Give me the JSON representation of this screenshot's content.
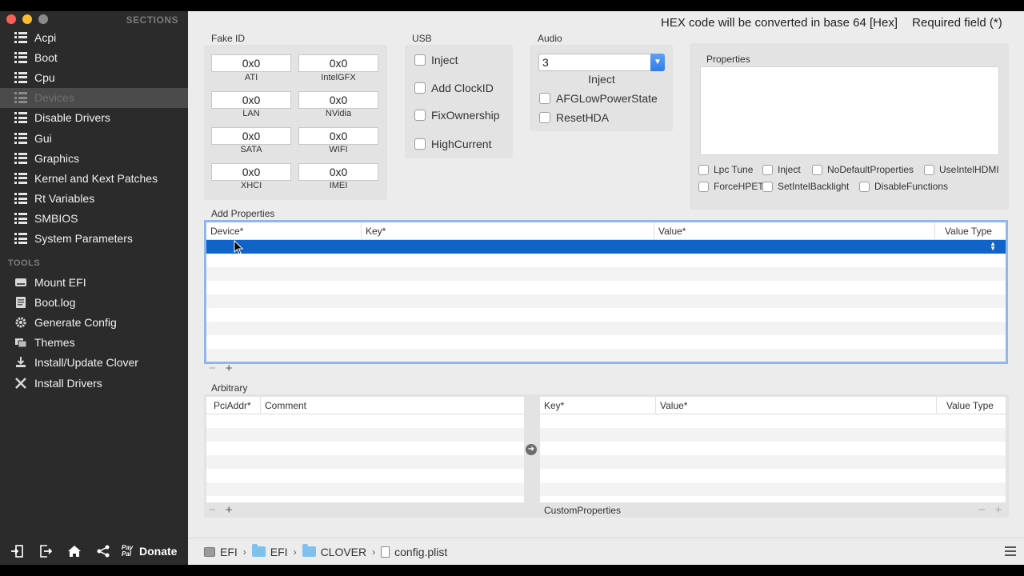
{
  "sidebar": {
    "sections_title": "SECTIONS",
    "items": [
      {
        "label": "Acpi",
        "icon": "list-icon"
      },
      {
        "label": "Boot",
        "icon": "list-icon"
      },
      {
        "label": "Cpu",
        "icon": "list-icon"
      },
      {
        "label": "Devices",
        "icon": "list-icon",
        "active": true
      },
      {
        "label": "Disable Drivers",
        "icon": "list-icon"
      },
      {
        "label": "Gui",
        "icon": "list-icon"
      },
      {
        "label": "Graphics",
        "icon": "list-icon"
      },
      {
        "label": "Kernel and Kext Patches",
        "icon": "list-icon"
      },
      {
        "label": "Rt Variables",
        "icon": "list-icon"
      },
      {
        "label": "SMBIOS",
        "icon": "list-icon"
      },
      {
        "label": "System Parameters",
        "icon": "list-icon"
      }
    ],
    "tools_title": "TOOLS",
    "tools": [
      {
        "label": "Mount EFI",
        "icon": "disk-icon"
      },
      {
        "label": "Boot.log",
        "icon": "log-icon"
      },
      {
        "label": "Generate Config",
        "icon": "gear-icon"
      },
      {
        "label": "Themes",
        "icon": "themes-icon"
      },
      {
        "label": "Install/Update Clover",
        "icon": "download-icon"
      },
      {
        "label": "Install Drivers",
        "icon": "tools-icon"
      }
    ],
    "footer": {
      "paypal_label": "Pay Pal",
      "donate_label": "Donate"
    }
  },
  "header": {
    "hex_note": "HEX code will be converted in base 64 [Hex]",
    "required_note": "Required field (*)"
  },
  "fake_id": {
    "label": "Fake ID",
    "fields": [
      {
        "value": "0x0",
        "caption": "ATI"
      },
      {
        "value": "0x0",
        "caption": "IntelGFX"
      },
      {
        "value": "0x0",
        "caption": "LAN"
      },
      {
        "value": "0x0",
        "caption": "NVidia"
      },
      {
        "value": "0x0",
        "caption": "SATA"
      },
      {
        "value": "0x0",
        "caption": "WIFI"
      },
      {
        "value": "0x0",
        "caption": "XHCI"
      },
      {
        "value": "0x0",
        "caption": "IMEI"
      }
    ]
  },
  "usb": {
    "label": "USB",
    "options": [
      "Inject",
      "Add ClockID",
      "FixOwnership",
      "HighCurrent"
    ]
  },
  "audio": {
    "label": "Audio",
    "inject_value": "3",
    "inject_label": "Inject",
    "options": [
      "AFGLowPowerState",
      "ResetHDA"
    ]
  },
  "properties": {
    "label": "Properties",
    "options_row1": [
      "Lpc Tune",
      "Inject",
      "NoDefaultProperties",
      "UseIntelHDMI"
    ],
    "options_row2": [
      "ForceHPET",
      "SetIntelBacklight",
      "DisableFunctions"
    ]
  },
  "add_properties": {
    "label": "Add Properties",
    "columns": [
      "Device*",
      "Key*",
      "Value*",
      "Value Type"
    ],
    "add_label": "+",
    "remove_label": "−"
  },
  "arbitrary": {
    "label": "Arbitrary",
    "left_columns": [
      "PciAddr*",
      "Comment"
    ],
    "right_columns": [
      "Key*",
      "Value*",
      "Value Type"
    ],
    "custom_properties_label": "CustomProperties",
    "add_label": "+",
    "remove_label": "−"
  },
  "pathbar": {
    "crumbs": [
      "EFI",
      "EFI",
      "CLOVER",
      "config.plist"
    ]
  }
}
